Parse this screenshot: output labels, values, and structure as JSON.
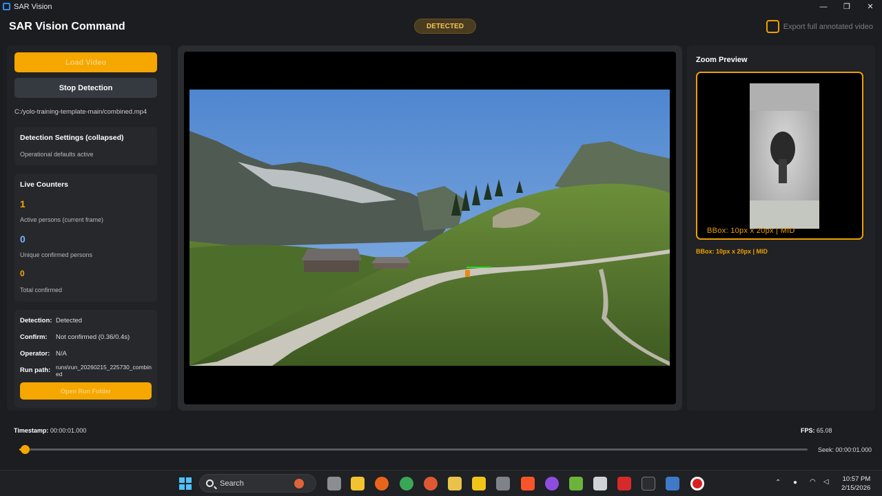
{
  "window": {
    "title": "SAR Vision",
    "minimize": "—",
    "maximize": "❐",
    "close": "✕"
  },
  "header": {
    "app_title": "SAR Vision Command",
    "status": "DETECTED",
    "export_label": "Export full annotated video",
    "export_checked": false
  },
  "left": {
    "load_button": "Load Video",
    "stop_button": "Stop Detection",
    "file_path": "C:/yolo-training-template-main/combined.mp4",
    "settings": {
      "title": "Detection Settings (collapsed)",
      "subtitle": "Operational defaults active"
    },
    "counters": {
      "title": "Live Counters",
      "active_value": "1",
      "active_label": "Active persons (current frame)",
      "unique_value": "0",
      "unique_label": "Unique confirmed persons",
      "total_value": "0",
      "total_label": "Total confirmed"
    },
    "detection": {
      "detection_label": "Detection:",
      "detection_value": "Detected",
      "confirm_label": "Confirm:",
      "confirm_value": "Not confirmed (0.36/0.4s)",
      "operator_label": "Operator:",
      "operator_value": "N/A",
      "runpath_label": "Run path:",
      "runpath_value": "runs\\run_20260215_225730_combined",
      "open_button": "Open Run Folder"
    }
  },
  "zoom": {
    "title": "Zoom Preview",
    "bbox_overlay": "BBox: 10px x 20px | MID",
    "bbox_caption": "BBox: 10px x 20px | MID"
  },
  "playback": {
    "timestamp_label": "Timestamp:",
    "timestamp_value": "00:00:01.000",
    "fps_label": "FPS:",
    "fps_value": "65.08",
    "seek_label": "Seek: 00:00:01.000",
    "seek_progress": 0.007
  },
  "taskbar": {
    "search_placeholder": "Search",
    "time": "10:57 PM",
    "date": "2/15/2026"
  },
  "colors": {
    "accent": "#f5a700",
    "counter_active": "#f5a700",
    "counter_unique": "#7fb2ff",
    "counter_total": "#f5a700"
  }
}
